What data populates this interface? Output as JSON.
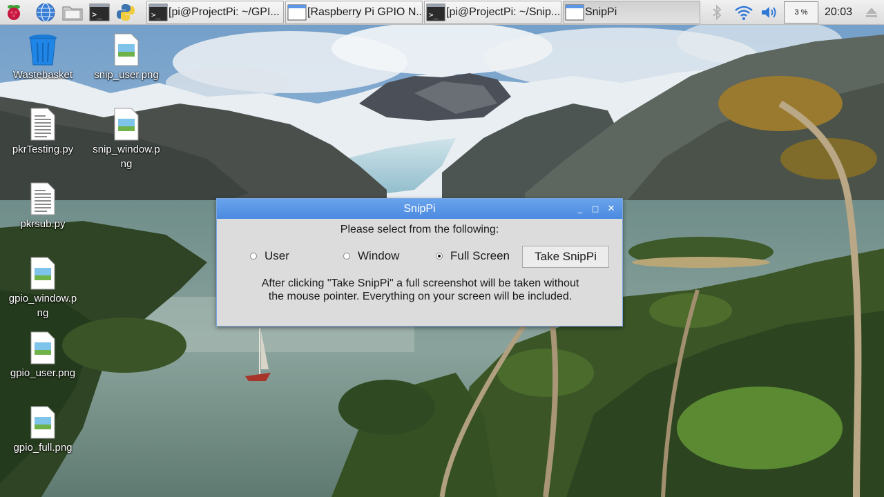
{
  "taskbar": {
    "launchers": [
      {
        "name": "raspberry-menu-icon"
      },
      {
        "name": "web-browser-icon"
      },
      {
        "name": "file-manager-icon"
      },
      {
        "name": "terminal-icon"
      },
      {
        "name": "python-icon"
      }
    ],
    "tasks": [
      {
        "label": "[pi@ProjectPi: ~/GPI...",
        "icon": "terminal-icon",
        "active": false
      },
      {
        "label": "[Raspberry Pi GPIO N...",
        "icon": "window-icon",
        "active": false
      },
      {
        "label": "[pi@ProjectPi: ~/Snip...",
        "icon": "terminal-icon",
        "active": false
      },
      {
        "label": "SnipPi",
        "icon": "window-icon",
        "active": true
      }
    ],
    "tray": {
      "bluetooth_icon": "bluetooth-icon",
      "wifi_icon": "wifi-icon",
      "volume_icon": "volume-icon",
      "cpu_usage": "3 %",
      "clock": "20:03",
      "eject_icon": "eject-icon"
    }
  },
  "desktop": {
    "icons": [
      {
        "label": "Wastebasket",
        "type": "trash"
      },
      {
        "label": "snip_user.png",
        "type": "image"
      },
      {
        "label": "pkrTesting.py",
        "type": "text"
      },
      {
        "label": "snip_window.png",
        "type": "image"
      },
      {
        "label": "pkrsub.py",
        "type": "text"
      },
      {
        "label": "gpio_window.png",
        "type": "image"
      },
      {
        "label": "gpio_user.png",
        "type": "image"
      },
      {
        "label": "gpio_full.png",
        "type": "image"
      }
    ]
  },
  "dialog": {
    "title": "SnipPi",
    "controls": {
      "minimize": "_",
      "maximize": "□",
      "close": "✕"
    },
    "prompt": "Please select from the following:",
    "options": [
      {
        "label": "User",
        "selected": false
      },
      {
        "label": "Window",
        "selected": false
      },
      {
        "label": "Full Screen",
        "selected": true
      }
    ],
    "button_label": "Take SnipPi",
    "info_line1": "After clicking \"Take SnipPi\" a full screenshot will be taken without",
    "info_line2": "the mouse pointer. Everything on your screen will be included."
  },
  "colors": {
    "titlebar": "#5b97e6",
    "dialog_bg": "#dcdcdc",
    "taskbar_bg": "#e6e6e6"
  }
}
